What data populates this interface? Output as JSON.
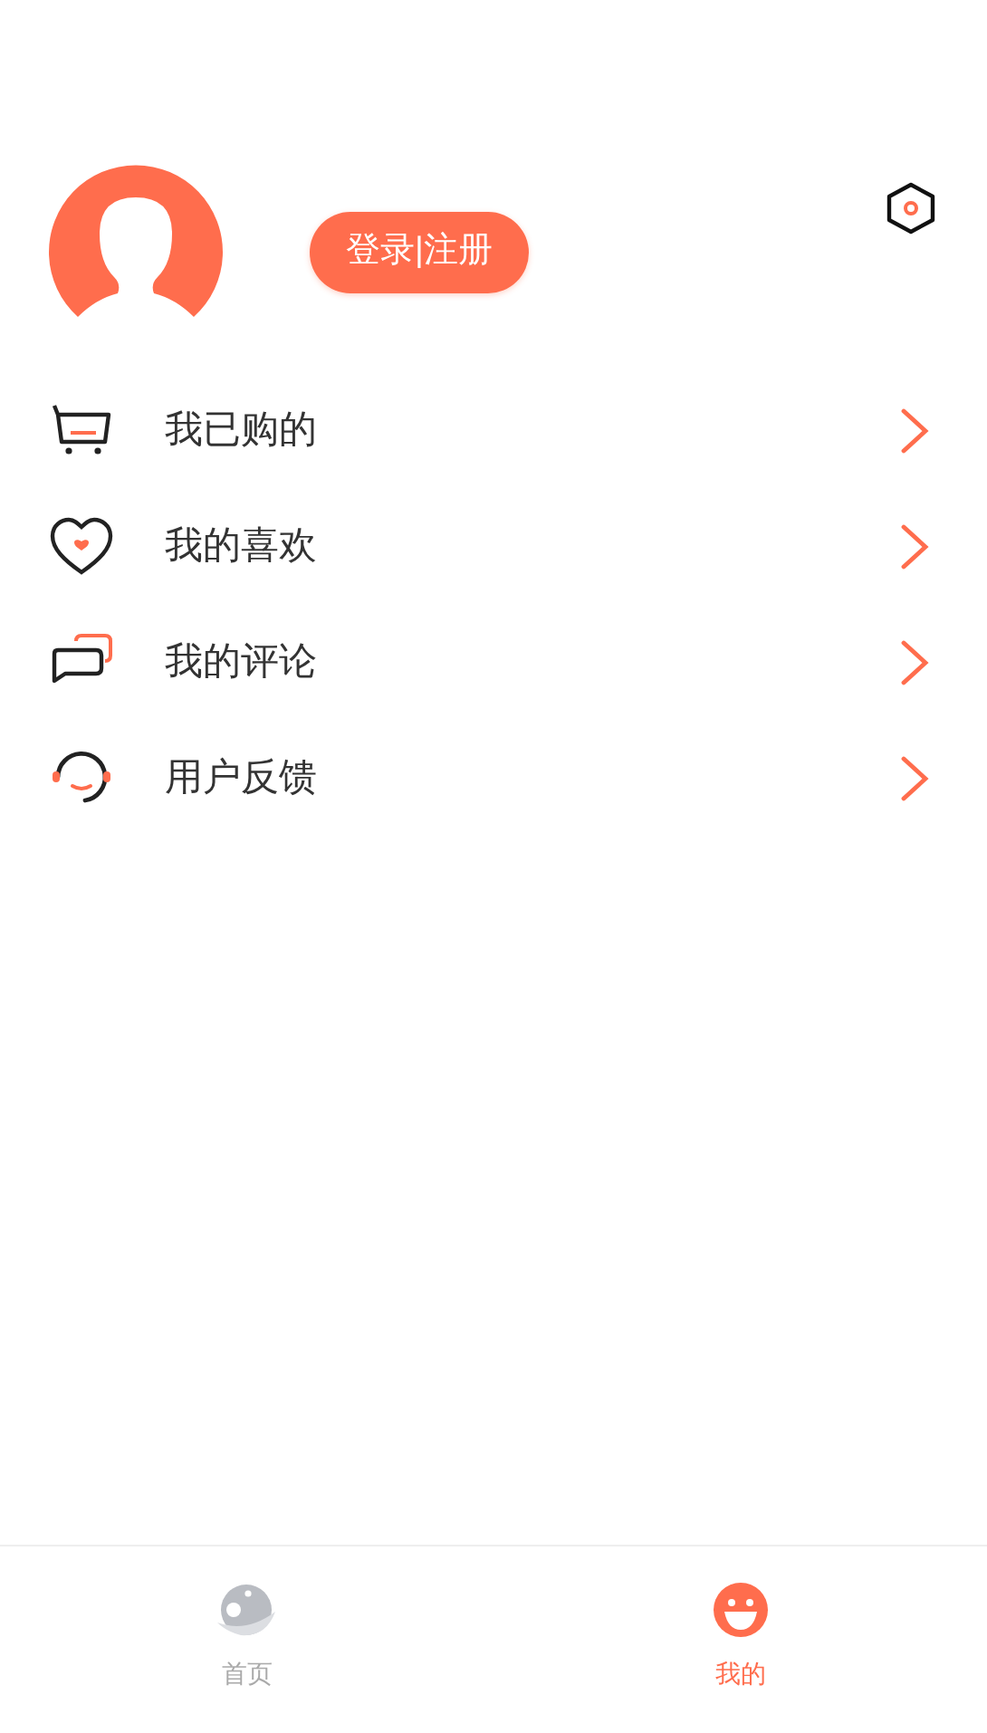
{
  "profile": {
    "login_button": "登录|注册"
  },
  "menu": [
    {
      "kind": "cart",
      "label": "我已购的"
    },
    {
      "kind": "heart",
      "label": "我的喜欢"
    },
    {
      "kind": "comment",
      "label": "我的评论"
    },
    {
      "kind": "feedback",
      "label": "用户反馈"
    }
  ],
  "tabs": [
    {
      "kind": "home",
      "label": "首页",
      "selected": false
    },
    {
      "kind": "me",
      "label": "我的",
      "selected": true
    }
  ]
}
